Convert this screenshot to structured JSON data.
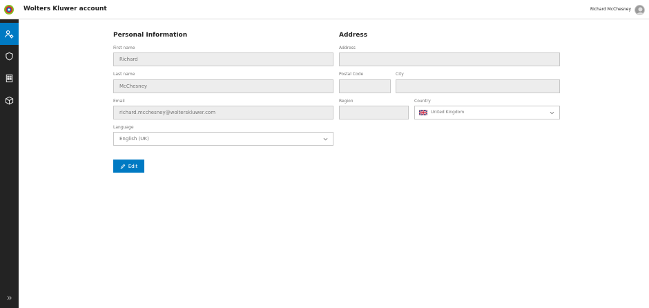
{
  "header": {
    "app_title": "Wolters Kluwer account",
    "user_name": "Richard McChesney"
  },
  "sidebar": {
    "items": [
      {
        "icon": "user-settings-icon",
        "active": true
      },
      {
        "icon": "shield-icon",
        "active": false
      },
      {
        "icon": "building-icon",
        "active": false
      },
      {
        "icon": "package-icon",
        "active": false
      }
    ],
    "expand_icon": "double-chevron-right-icon"
  },
  "personal": {
    "title": "Personal Information",
    "first_name_label": "First name",
    "first_name_value": "Richard",
    "last_name_label": "Last name",
    "last_name_value": "McChesney",
    "email_label": "Email",
    "email_value": "richard.mcchesney@wolterskluwer.com",
    "language_label": "Language",
    "language_value": "English (UK)"
  },
  "address": {
    "title": "Address",
    "address_label": "Address",
    "address_value": "",
    "postal_code_label": "Postal Code",
    "postal_code_value": "",
    "city_label": "City",
    "city_value": "",
    "region_label": "Region",
    "region_value": "",
    "country_label": "Country",
    "country_value": "United Kingdom"
  },
  "actions": {
    "edit_label": "Edit"
  },
  "colors": {
    "accent": "#007ac3",
    "sidebar_bg": "#232323",
    "field_bg": "#ededed"
  }
}
